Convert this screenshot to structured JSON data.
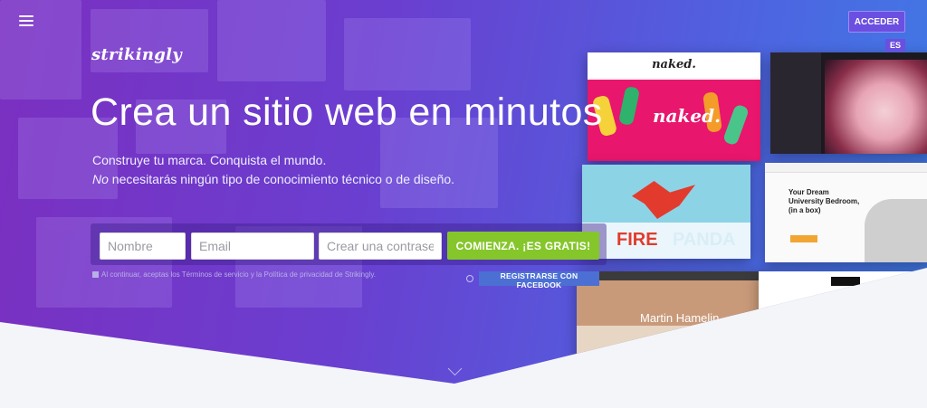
{
  "nav": {
    "login_label": "ACCEDER",
    "language": "ES"
  },
  "brand": {
    "logo_text": "strikingly"
  },
  "hero": {
    "title": "Crea un sitio web en minutos",
    "subtitle_line1": "Construye tu marca. Conquista el mundo.",
    "subtitle_line2_em": "No",
    "subtitle_line2_rest": " necesitarás ningún tipo de conocimiento técnico o de diseño."
  },
  "signup": {
    "name_placeholder": "Nombre",
    "email_placeholder": "Email",
    "password_placeholder": "Crear una contraseña",
    "submit_label": "COMIENZA. ¡ES GRATIS!",
    "terms_text": "Al continuar, aceptas los Términos de servicio y la Política de privacidad de Strikingly.",
    "facebook_label": "REGISTRARSE CON FACEBOOK"
  },
  "showcase": {
    "naked_brand": "naked.",
    "fire_text": "FIRE",
    "panda_text": "PANDA",
    "dream_title": "Your Dream University Bedroom, (in a box)",
    "martin_name": "Martin Hamelin"
  },
  "colors": {
    "accent_green": "#85c62b",
    "facebook_blue": "#4c6fd4",
    "login_purple": "#6b4fe0"
  }
}
